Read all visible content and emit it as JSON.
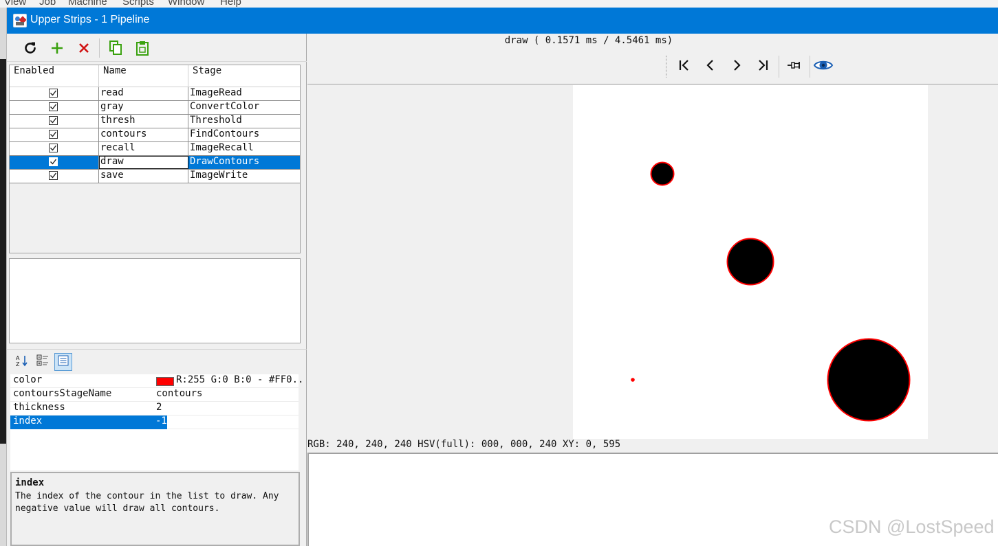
{
  "background_menu": [
    "View",
    "Job",
    "Machine",
    "Scripts",
    "Window",
    "Help"
  ],
  "window": {
    "title": "Upper Strips - 1 Pipeline"
  },
  "toolbar": {
    "refresh_icon": "refresh-icon",
    "add_icon": "plus-icon",
    "delete_icon": "x-icon",
    "copy_icon": "copy-icon",
    "paste_icon": "clipboard-icon",
    "add_color": "#3aa10f",
    "delete_color": "#d01010"
  },
  "stages": {
    "columns": [
      "Enabled",
      "Name",
      "Stage"
    ],
    "rows": [
      {
        "enabled": true,
        "name": "read",
        "stage": "ImageRead"
      },
      {
        "enabled": true,
        "name": "gray",
        "stage": "ConvertColor"
      },
      {
        "enabled": true,
        "name": "thresh",
        "stage": "Threshold"
      },
      {
        "enabled": true,
        "name": "contours",
        "stage": "FindContours"
      },
      {
        "enabled": true,
        "name": "recall",
        "stage": "ImageRecall"
      },
      {
        "enabled": true,
        "name": "draw",
        "stage": "DrawContours",
        "selected": true
      },
      {
        "enabled": true,
        "name": "save",
        "stage": "ImageWrite"
      }
    ]
  },
  "properties": {
    "toolbar_icons": [
      "sort-alphabetical-icon",
      "categorized-icon",
      "property-pages-icon"
    ],
    "rows": [
      {
        "key": "color",
        "value": "R:255 G:0 B:0 - #FF0..",
        "swatch": "#ff0000"
      },
      {
        "key": "contoursStageName",
        "value": "contours"
      },
      {
        "key": "thickness",
        "value": "2"
      },
      {
        "key": "index",
        "value": "-1",
        "selected": true
      }
    ]
  },
  "description": {
    "title": "index",
    "text": "The index of the contour in the list to draw. Any negative value will draw all contours."
  },
  "viewer": {
    "timing": "draw ( 0.1571 ms / 4.5461 ms)",
    "nav_icons": [
      "first-icon",
      "previous-icon",
      "next-icon",
      "last-icon",
      "pin-icon",
      "eye-icon"
    ],
    "pixel_info": "RGB: 240, 240, 240 HSV(full): 000, 000, 240 XY: 0, 595",
    "accent": "#0078d7",
    "contour_color": "#ff0000"
  },
  "watermark": "CSDN @LostSpeed"
}
